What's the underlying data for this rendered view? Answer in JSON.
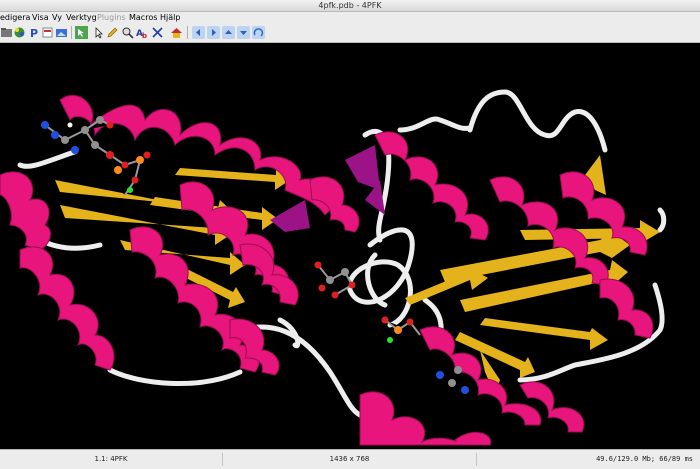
{
  "window": {
    "title": "4pfk.pdb - 4PFK"
  },
  "menu": {
    "items": [
      "edigera",
      "Visa",
      "Vy",
      "Verktyg",
      "Plugins",
      "Macros",
      "Hjälp"
    ]
  },
  "toolbar": {
    "icons": [
      "open-icon",
      "molecule-icon",
      "script-icon",
      "print-icon",
      "image-export-icon",
      "select-icon",
      "pointer-icon",
      "pencil-icon",
      "zoom-icon",
      "label-icon",
      "measure-icon",
      "home-icon",
      "nav-left-icon",
      "nav-right-icon",
      "nav-up-icon",
      "nav-down-icon",
      "rotate-icon"
    ]
  },
  "colors": {
    "helix": "#e8157c",
    "sheet": "#e4b21a",
    "coil": "#eeeeee",
    "turn": "#9b1386",
    "background": "#000000"
  },
  "status": {
    "model": "1.1: 4PFK",
    "dimensions": "1436 x 768",
    "memory": "49.6/129.0 Mb;  66/89 ms"
  }
}
